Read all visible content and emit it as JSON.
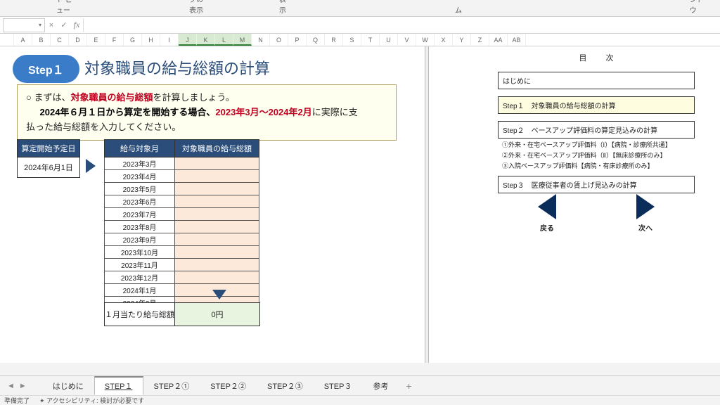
{
  "ribbon": {
    "grp1": "シート ビュー",
    "grp2": "ブックの表示",
    "grp3": "表示",
    "grp4": "ズーム",
    "grp5": "ウィンドウ"
  },
  "columns": [
    "A",
    "B",
    "C",
    "D",
    "E",
    "F",
    "G",
    "H",
    "I",
    "J",
    "K",
    "L",
    "M",
    "N",
    "O",
    "P",
    "Q",
    "R",
    "S",
    "T",
    "U",
    "V",
    "W",
    "X",
    "Y",
    "Z",
    "AA",
    "AB"
  ],
  "selected_cols": [
    "J",
    "K",
    "L",
    "M"
  ],
  "step_badge": "Step１",
  "step_title": "対象職員の給与総額の計算",
  "instr": {
    "line1_pre": "○ まずは、",
    "line1_bold": "対象職員の給与総額",
    "line1_post": "を計算しましょう。",
    "line2_b1": "2024年６月１日から算定を開始する場合、",
    "line2_b2": "2023年3月～2024年2月",
    "line2_tail1": "に実際に支",
    "line2_tail2": "払った給与総額を入力してください。"
  },
  "date_box": {
    "hdr": "算定開始予定日",
    "val": "2024年6月1日"
  },
  "table": {
    "h1": "給与対象月",
    "h2": "対象職員の給与総額",
    "months": [
      "2023年3月",
      "2023年4月",
      "2023年5月",
      "2023年6月",
      "2023年7月",
      "2023年8月",
      "2023年9月",
      "2023年10月",
      "2023年11月",
      "2023年12月",
      "2024年1月",
      "2024年2月"
    ]
  },
  "avg": {
    "label": "１月当たり給与総額",
    "value": "0円"
  },
  "toc": {
    "title": "目 次",
    "hajime": "はじめに",
    "s1": "Step１　対象職員の給与総額の計算",
    "s2": "Step２　ベースアップ評価料の算定見込みの計算",
    "s2a": "①外来・在宅ベースアップ評価料（Ⅰ）【病院・診療所共通】",
    "s2b": "②外来・在宅ベースアップ評価料（Ⅱ）【無床診療所のみ】",
    "s2c": "③入院ベースアップ評価料【病院・有床診療所のみ】",
    "s3": "Step３　医療従事者の賃上げ見込みの計算",
    "back": "戻る",
    "next": "次へ"
  },
  "tabs": {
    "items": [
      "はじめに",
      "STEP１",
      "STEP２①",
      "STEP２②",
      "STEP２③",
      "STEP３",
      "参考"
    ],
    "active": 1
  },
  "status": {
    "s1": "準備完了",
    "s2": "アクセシビリティ: 検討が必要です"
  }
}
